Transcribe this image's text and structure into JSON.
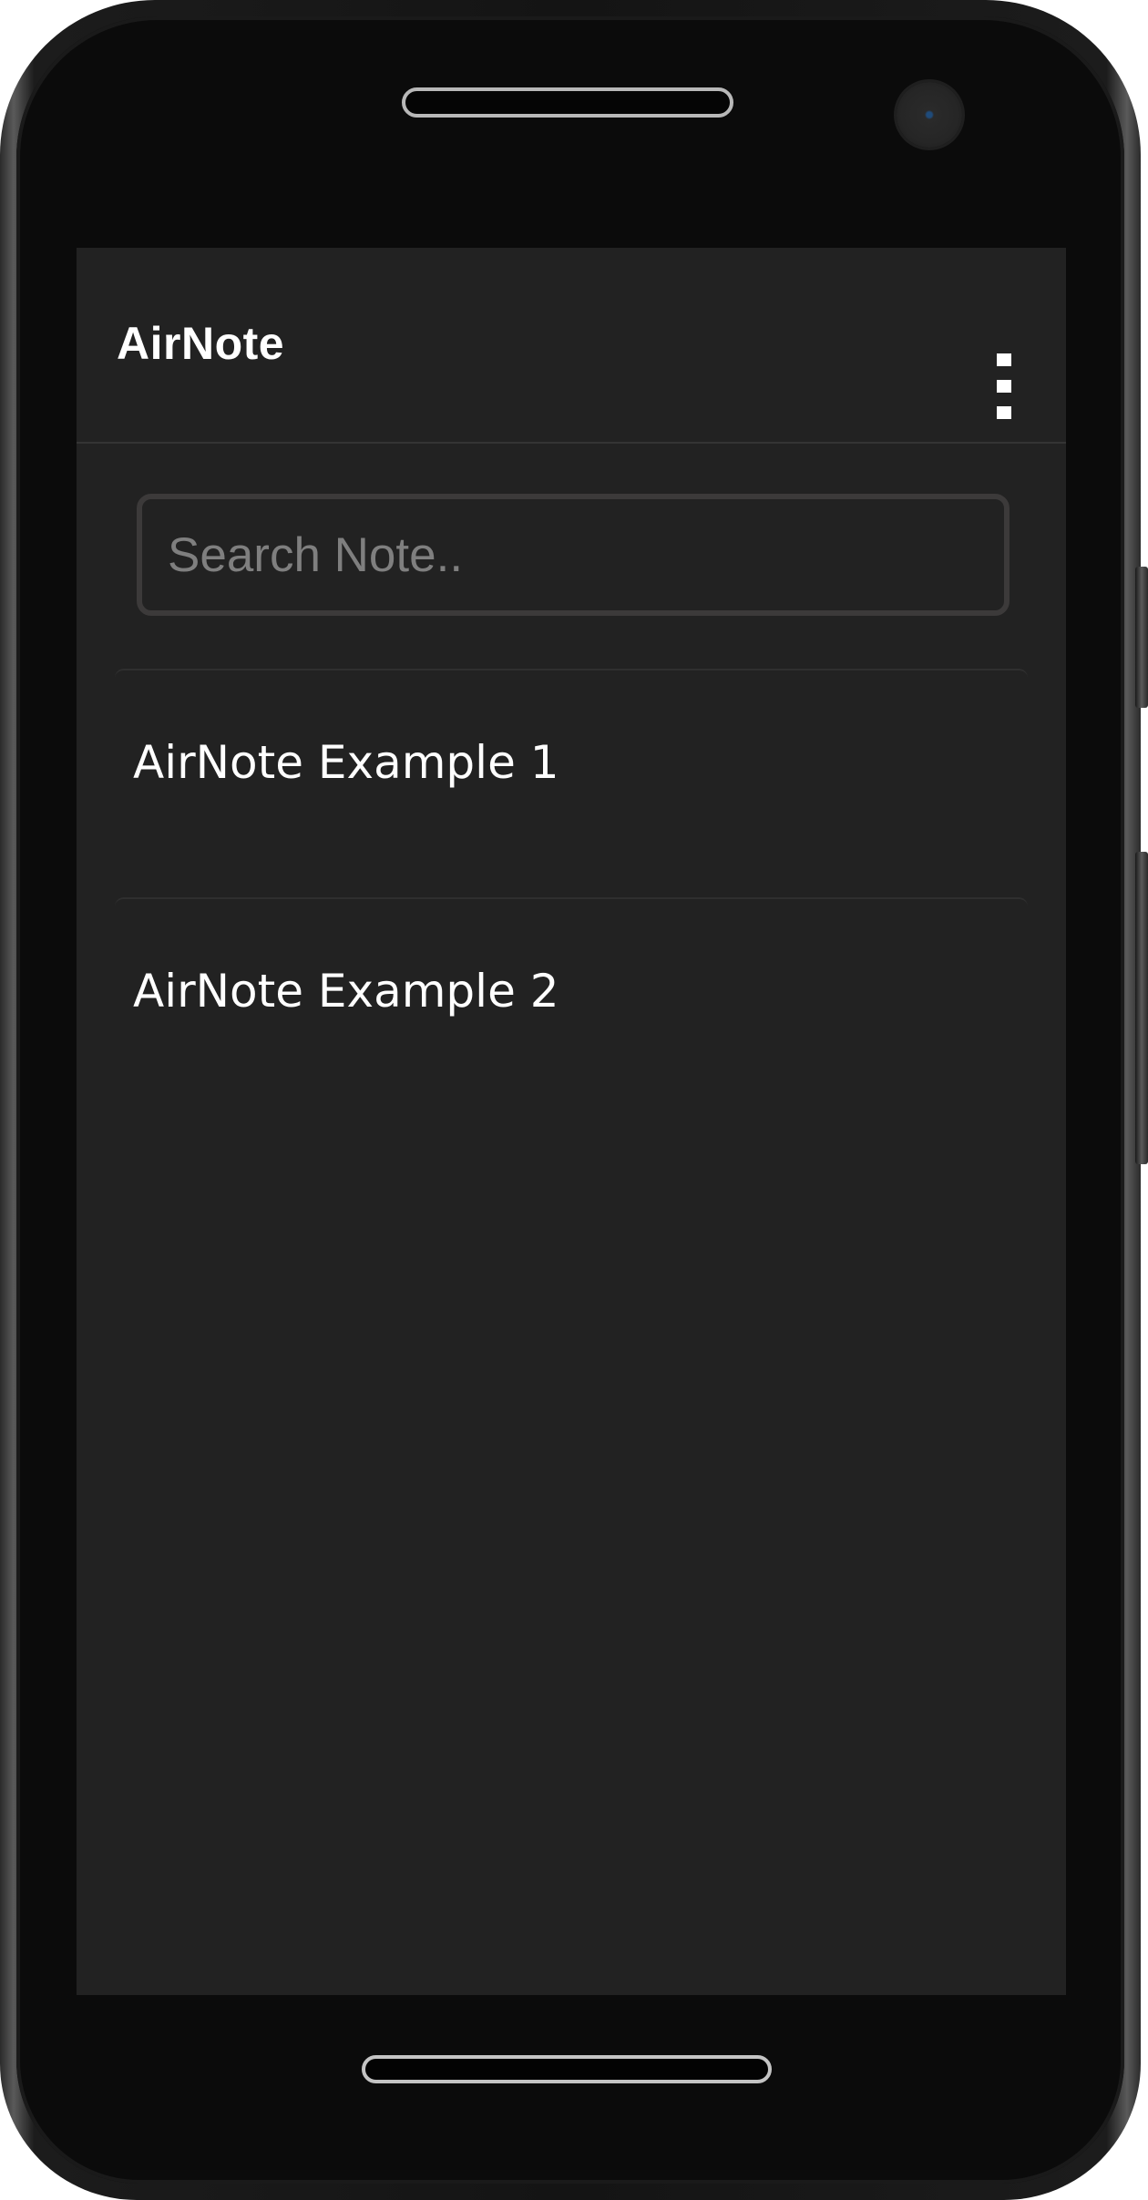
{
  "app": {
    "title": "AirNote"
  },
  "toolbar": {
    "menu_icon": "more-vertical-icon"
  },
  "search": {
    "placeholder": "Search Note..",
    "value": ""
  },
  "notes": [
    {
      "title": "AirNote Example 1"
    },
    {
      "title": "AirNote Example 2"
    }
  ],
  "colors": {
    "screen_background": "#222222",
    "text": "#ffffff",
    "placeholder": "#7f7f7f",
    "search_border": "#3c3a3a",
    "device_body": "#0b0b0b"
  }
}
